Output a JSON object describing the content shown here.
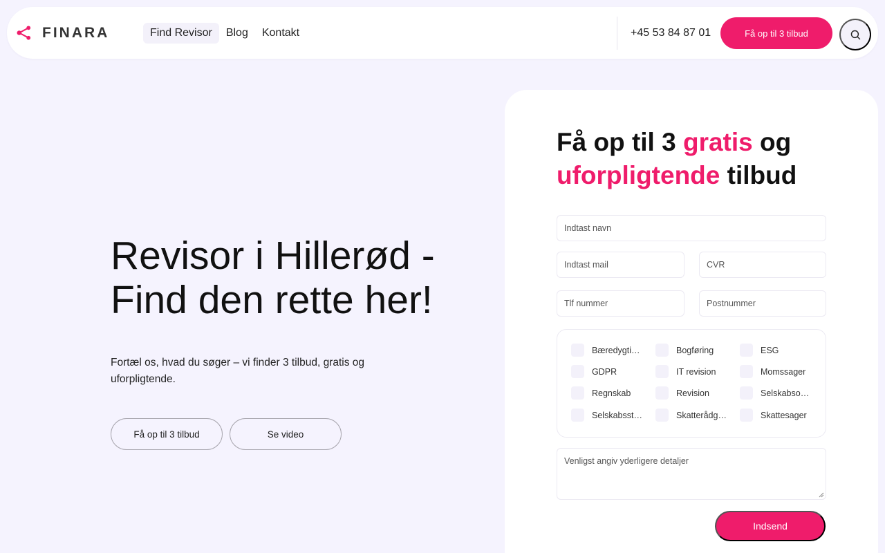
{
  "header": {
    "brand": "FINARA",
    "nav": [
      {
        "label": "Find Revisor",
        "active": true
      },
      {
        "label": "Blog",
        "active": false
      },
      {
        "label": "Kontakt",
        "active": false
      }
    ],
    "phone": "+45 53 84 87 01",
    "cta_label": "Få op til 3 tilbud",
    "search_icon": "search-icon"
  },
  "hero": {
    "title_line1": "Revisor i Hillerød -",
    "title_line2": "Find den rette her!",
    "subtitle": "Fortæl os, hvad du søger – vi finder 3 tilbud, gratis og uforpligtende.",
    "primary_button": "Få op til 3 tilbud",
    "secondary_button": "Se video"
  },
  "form": {
    "title_part1": "Få op til 3 ",
    "title_highlight1": "gratis",
    "title_part2": " og",
    "title_highlight2": "uforpligtende",
    "title_part3": " tilbud",
    "fields": {
      "name": "Indtast navn",
      "mail": "Indtast mail",
      "cvr": "CVR",
      "phone": "Tlf nummer",
      "postal": "Postnummer"
    },
    "checkboxes": [
      "Bæredygtighed",
      "Bogføring",
      "ESG",
      "GDPR",
      "IT revision",
      "Momssager",
      "Regnskab",
      "Revision",
      "Selskabsomdannelse",
      "Selskabsstiftelse",
      "Skatterådgivning",
      "Skattesager"
    ],
    "details_placeholder": "Venligst angiv yderligere detaljer",
    "submit_label": "Indsend"
  },
  "colors": {
    "accent": "#ef1c6b",
    "background": "#f5f3fe"
  }
}
